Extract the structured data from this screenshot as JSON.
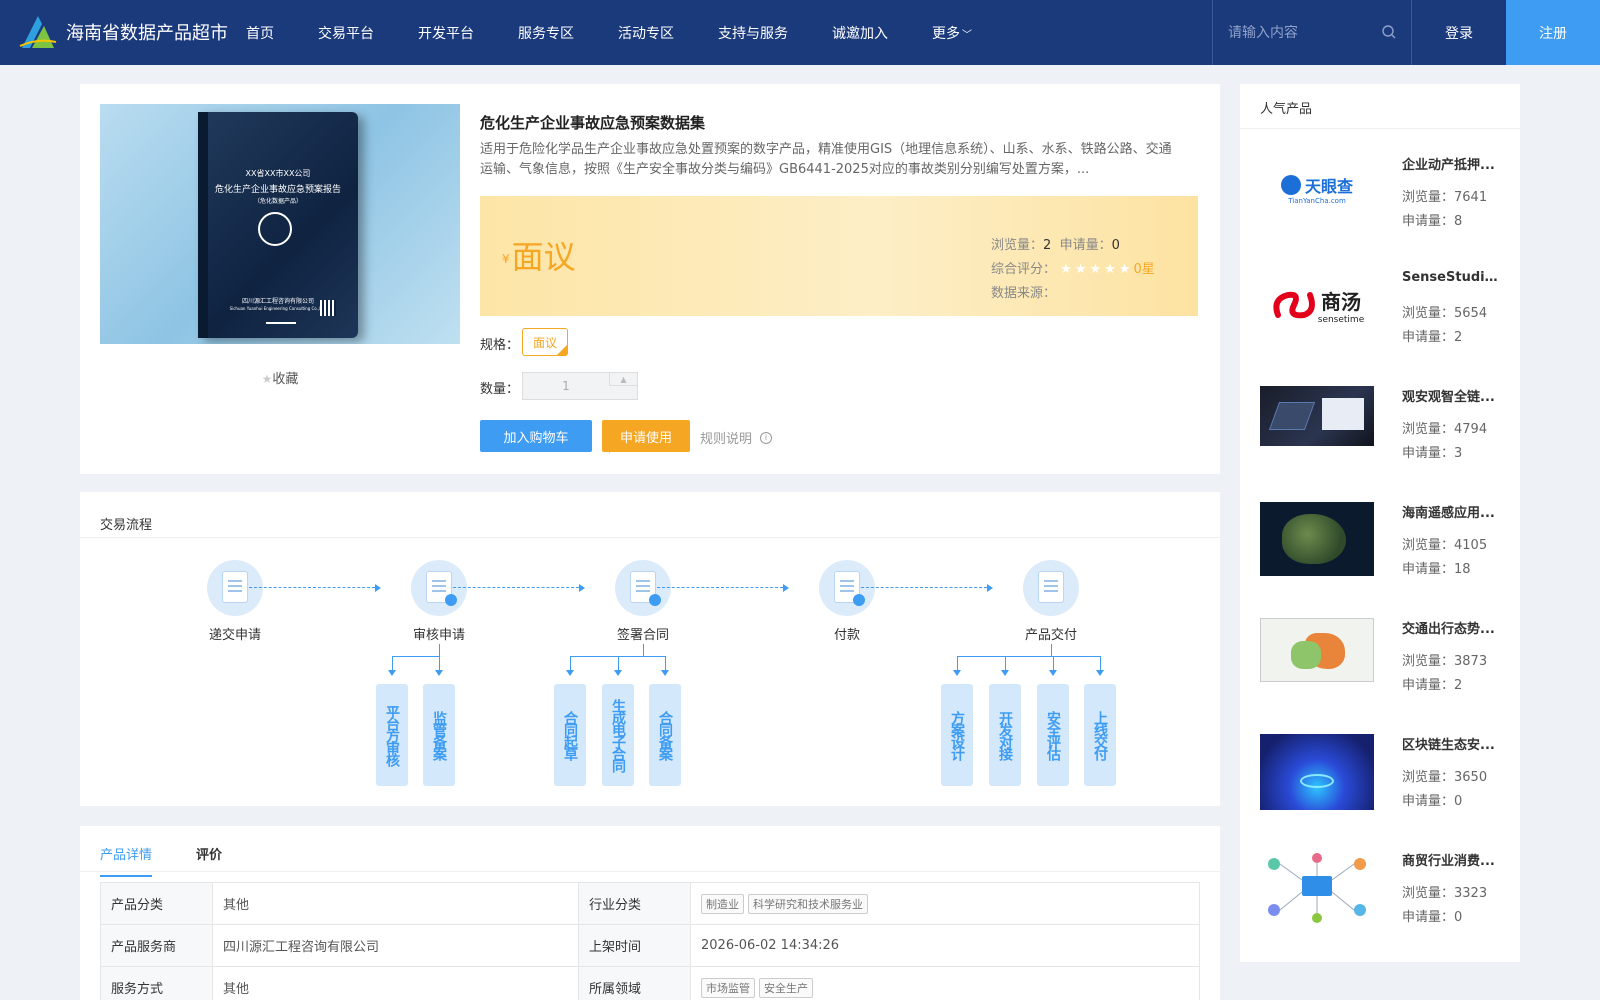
{
  "header": {
    "site_title": "海南省数据产品超市",
    "nav": [
      "首页",
      "交易平台",
      "开发平台",
      "服务专区",
      "活动专区",
      "支持与服务",
      "诚邀加入",
      "更多"
    ],
    "search_placeholder": "请输入内容",
    "login": "登录",
    "register": "注册"
  },
  "product": {
    "title": "危化生产企业事故应急预案数据集",
    "description": "适用于危险化学品生产企业事故应急处置预案的数字产品，精准使用GIS（地理信息系统）、山系、水系、铁路公路、交通运输、气象信息，按照《生产安全事故分类与编码》GB6441-2025对应的事故类别分别编写处置方案，...",
    "cover": {
      "line1": "XX省XX市XX公司",
      "line2": "危化生产企业事故应急预案报告",
      "line3": "（危化数据产品）",
      "company": "四川源汇工程咨询有限公司",
      "company_en": "Sichuan Yuanhui Engineering Consulting Co.,LTD"
    },
    "favorite": "收藏",
    "price_symbol": "¥",
    "price": "面议",
    "views_label": "浏览量：",
    "views": "2",
    "applies_label": "申请量：",
    "applies": "0",
    "rating_label": "综合评分：",
    "rating_stars": "★★★★★",
    "rating": "0星",
    "source_label": "数据来源：",
    "spec_label": "规格：",
    "spec_value": "面议",
    "qty_label": "数量：",
    "qty_value": "1",
    "btn_cart": "加入购物车",
    "btn_apply": "申请使用",
    "rules": "规则说明"
  },
  "process": {
    "title": "交易流程",
    "steps": [
      "递交申请",
      "审核申请",
      "签署合同",
      "付款",
      "产品交付"
    ],
    "substeps": {
      "review": [
        "平台方审核",
        "监管备案"
      ],
      "contract": [
        "合同起草",
        "生成电子合同",
        "合同备案"
      ],
      "delivery": [
        "方案设计",
        "开发对接",
        "安全评估",
        "上线交付"
      ]
    }
  },
  "details": {
    "tabs": [
      "产品详情",
      "评价"
    ],
    "rows": [
      {
        "k1": "产品分类",
        "v1": "其他",
        "k2": "行业分类",
        "tags": [
          "制造业",
          "科学研究和技术服务业"
        ]
      },
      {
        "k1": "产品服务商",
        "v1": "四川源汇工程咨询有限公司",
        "k2": "上架时间",
        "v2": "2026-06-02 14:34:26"
      },
      {
        "k1": "服务方式",
        "v1": "其他",
        "k2": "所属领域",
        "tags": [
          "市场监管",
          "安全生产"
        ]
      }
    ]
  },
  "popular": {
    "title": "人气产品",
    "views_label": "浏览量：",
    "applies_label": "申请量：",
    "items": [
      {
        "name": "企业动产抵押...",
        "views": "7641",
        "applies": "8",
        "thumb_text": "天眼查",
        "thumb_sub": "TianYanCha.com"
      },
      {
        "name": "SenseStudio...",
        "views": "5654",
        "applies": "2",
        "thumb_text": "商汤",
        "thumb_sub": "sensetime"
      },
      {
        "name": "观安观智全链...",
        "views": "4794",
        "applies": "3"
      },
      {
        "name": "海南遥感应用...",
        "views": "4105",
        "applies": "18"
      },
      {
        "name": "交通出行态势...",
        "views": "3873",
        "applies": "2"
      },
      {
        "name": "区块链生态安...",
        "views": "3650",
        "applies": "0"
      },
      {
        "name": "商贸行业消费...",
        "views": "3323",
        "applies": "0"
      }
    ]
  },
  "colors": {
    "header": "#1b3a7c",
    "primary": "#3e9cf2",
    "accent": "#f5a623"
  }
}
